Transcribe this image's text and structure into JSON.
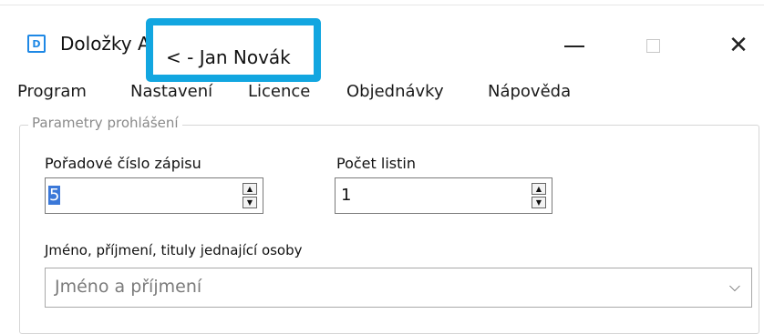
{
  "window": {
    "app_icon_glyph": "D",
    "title_visible": "Doložky A",
    "title_highlighted": "< - Jan Novák",
    "minimize_glyph": "—",
    "maximize_glyph": "",
    "close_glyph": "✕",
    "highlight_color": "#12a6e0"
  },
  "menu": {
    "items": [
      "Program",
      "Nastavení",
      "Licence",
      "Objednávky",
      "Nápověda"
    ]
  },
  "group": {
    "legend": "Parametry prohlášení"
  },
  "form": {
    "order_number": {
      "label": "Pořadové číslo zápisu",
      "value": "5"
    },
    "page_count": {
      "label": "Počet listin",
      "value": "1"
    },
    "person": {
      "label": "Jméno, příjmení, tituly jednající osoby",
      "placeholder": "Jméno a příjmení",
      "chevron": "⌵"
    },
    "spin_up": "▲",
    "spin_down": "▼"
  },
  "icons": {
    "app": "app-icon",
    "minimize": "minimize-icon",
    "maximize": "maximize-icon",
    "close": "close-icon",
    "dropdown": "chevron-down-icon"
  }
}
